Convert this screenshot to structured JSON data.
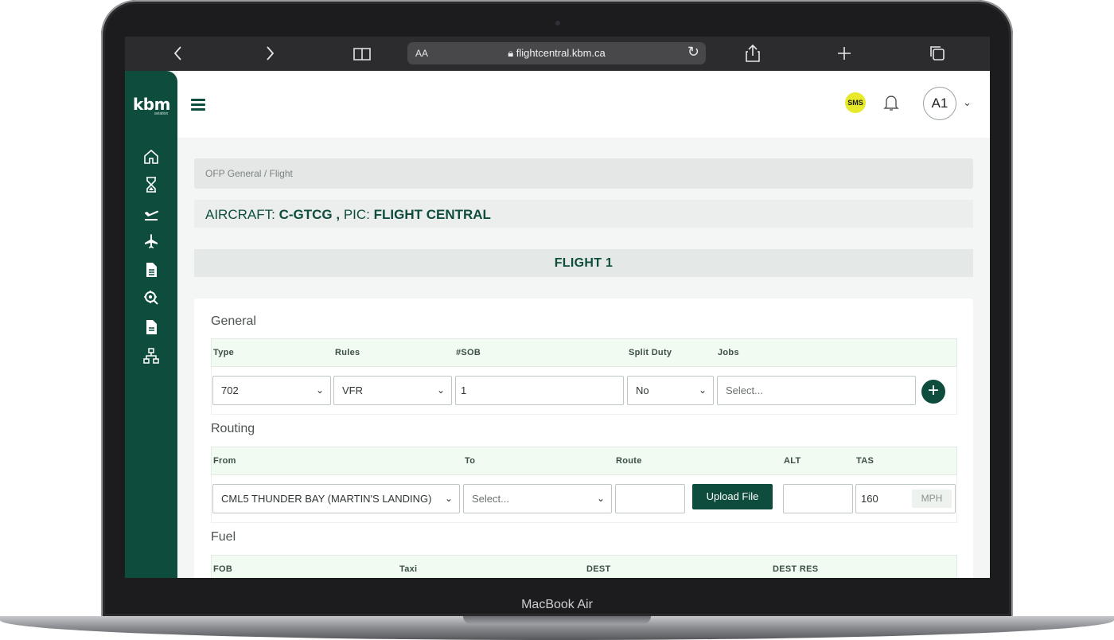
{
  "device": {
    "label": "MacBook Air"
  },
  "browser": {
    "text_size_label": "AA",
    "url": "flightcentral.kbm.ca"
  },
  "sidebar": {
    "logo": "kbm",
    "logo_sub": "aviation"
  },
  "topbar": {
    "sms_label": "SMS",
    "avatar_label": "A1"
  },
  "breadcrumb": {
    "part1": "OFP General",
    "separator": "/",
    "part2": "Flight"
  },
  "aircraft": {
    "aircraft_prefix": "AIRCRAFT:",
    "aircraft_value": "C-GTCG",
    "separator": ",",
    "pic_prefix": "PIC:",
    "pic_value": "FLIGHT CENTRAL"
  },
  "flight": {
    "title": "FLIGHT 1"
  },
  "general": {
    "title": "General",
    "headers": {
      "type": "Type",
      "rules": "Rules",
      "sob": "#SOB",
      "split_duty": "Split Duty",
      "jobs": "Jobs"
    },
    "values": {
      "type": "702",
      "rules": "VFR",
      "sob": "1",
      "split_duty": "No",
      "jobs_placeholder": "Select..."
    }
  },
  "routing": {
    "title": "Routing",
    "headers": {
      "from": "From",
      "to": "To",
      "route": "Route",
      "alt": "ALT",
      "tas": "TAS"
    },
    "values": {
      "from": "CML5 THUNDER BAY (MARTIN'S LANDING)",
      "to_placeholder": "Select...",
      "route": "",
      "upload_button": "Upload File",
      "alt": "",
      "tas": "160",
      "tas_unit": "MPH"
    }
  },
  "fuel": {
    "title": "Fuel",
    "headers": {
      "fob": "FOB",
      "taxi": "Taxi",
      "dest": "DEST",
      "dest_res": "DEST RES"
    }
  }
}
